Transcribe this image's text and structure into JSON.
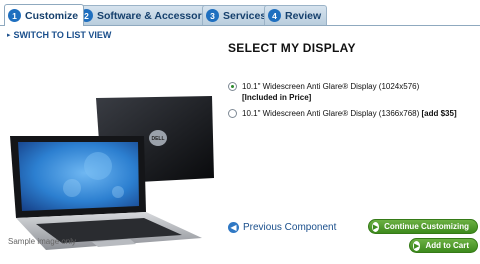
{
  "tabs": [
    {
      "num": "1",
      "label": "Customize"
    },
    {
      "num": "2",
      "label": "Software & Accessories"
    },
    {
      "num": "3",
      "label": "Services"
    },
    {
      "num": "4",
      "label": "Review"
    }
  ],
  "links": {
    "switch_view": "SWITCH TO LIST VIEW",
    "previous": "Previous Component"
  },
  "section": {
    "title": "SELECT MY DISPLAY"
  },
  "options": [
    {
      "label": "10.1\" Widescreen Anti Glare® Display (1024x576)",
      "note": "[Included in Price]",
      "selected": true
    },
    {
      "label": "10.1\" Widescreen Anti Glare® Display (1366x768)",
      "note": "[add $35]",
      "selected": false
    }
  ],
  "product": {
    "brand": "DELL",
    "caption": "Sample image only"
  },
  "buttons": {
    "continue": "Continue Customizing",
    "cart": "Add to Cart"
  },
  "colors": {
    "accent": "#1f6fbf",
    "button": "#4e9c2a"
  }
}
